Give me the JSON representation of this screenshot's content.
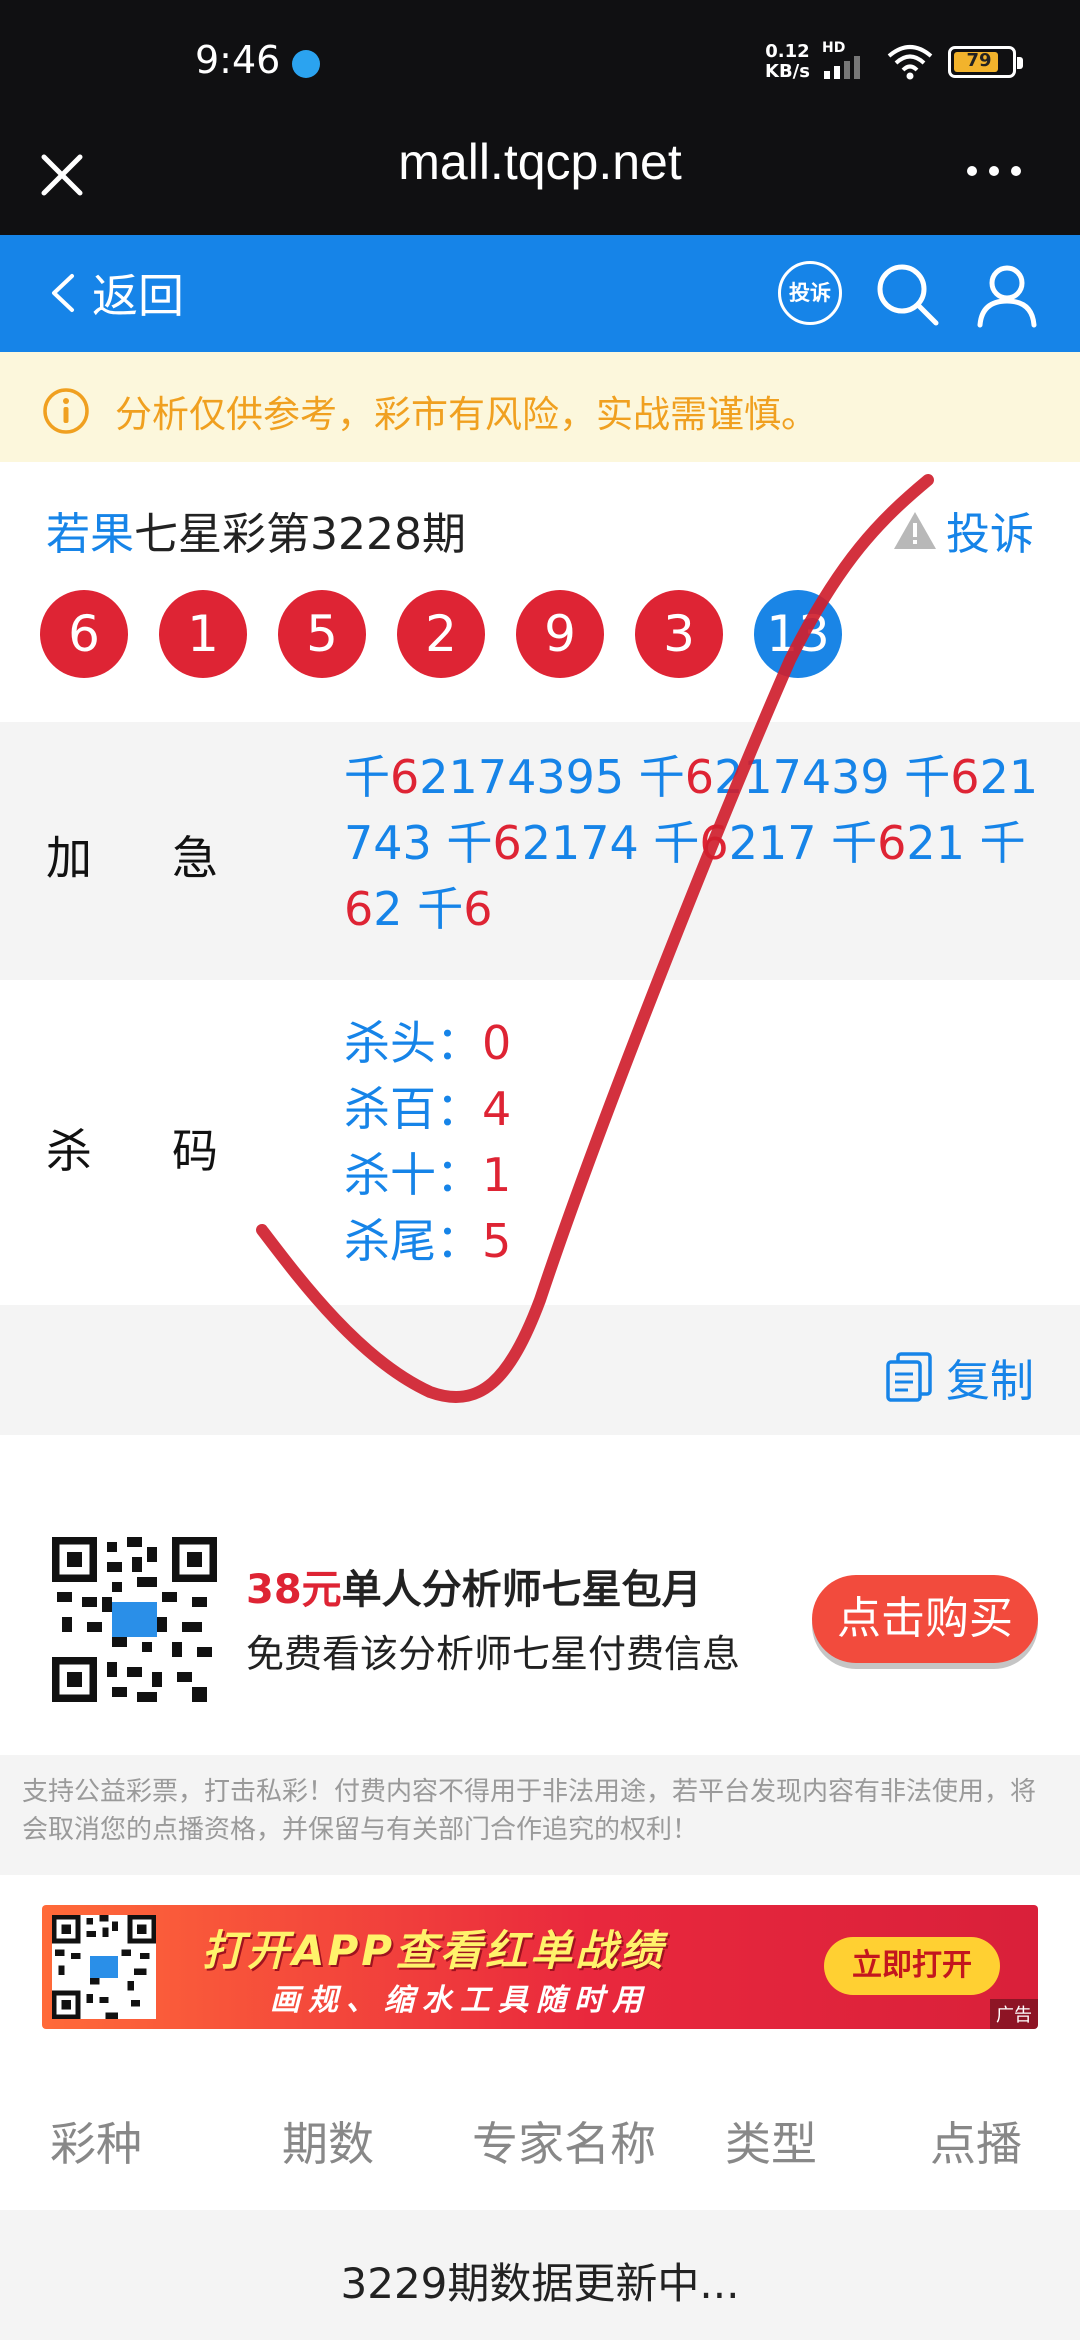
{
  "status_bar": {
    "time": "9:46",
    "net_speed_value": "0.12",
    "net_speed_unit": "KB/s",
    "net_type": "HD",
    "battery": "79"
  },
  "browser": {
    "url": "mall.tqcp.net"
  },
  "header": {
    "back_label": "返回",
    "complain_label": "投诉"
  },
  "notice": {
    "text": "分析仅供参考，彩市有风险，实战需谨慎。"
  },
  "issue": {
    "expert_name": "若果",
    "title": "七星彩第3228期",
    "report_label": "投诉",
    "balls": [
      "6",
      "1",
      "5",
      "2",
      "9",
      "3",
      "13"
    ]
  },
  "analysis": {
    "rows": [
      {
        "label": "加急",
        "items": [
          {
            "prefix": "千",
            "lead": "6",
            "rest": "2174395"
          },
          {
            "prefix": "千",
            "lead": "6",
            "rest": "217439"
          },
          {
            "prefix": "千",
            "lead": "6",
            "rest": "21743"
          },
          {
            "prefix": "千",
            "lead": "6",
            "rest": "2174"
          },
          {
            "prefix": "千",
            "lead": "6",
            "rest": "217"
          },
          {
            "prefix": "千",
            "lead": "6",
            "rest": "21"
          },
          {
            "prefix": "千",
            "lead": "6",
            "rest": "2"
          },
          {
            "prefix": "千",
            "lead": "6",
            "rest": ""
          }
        ]
      },
      {
        "label": "杀码",
        "items": [
          {
            "key": "杀头：",
            "value": "0"
          },
          {
            "key": "杀百：",
            "value": "4"
          },
          {
            "key": "杀十：",
            "value": "1"
          },
          {
            "key": "杀尾：",
            "value": "5"
          }
        ]
      }
    ],
    "copy_label": "复制"
  },
  "promo": {
    "price": "38元",
    "title": "单人分析师七星包月",
    "subtitle": "免费看该分析师七星付费信息",
    "button": "点击购买"
  },
  "disclaimer": "支持公益彩票，打击私彩！付费内容不得用于非法用途，若平台发现内容有非法使用，将会取消您的点播资格，并保留与有关部门合作追究的权利！",
  "banner": {
    "line1": "打开APP查看红单战绩",
    "line2": "画规、缩水工具随时用",
    "button": "立即打开",
    "ad_tag": "广告"
  },
  "table": {
    "columns": [
      "彩种",
      "期数",
      "专家名称",
      "类型",
      "点播"
    ],
    "status_row": "3229期数据更新中..."
  },
  "colors": {
    "accent_blue": "#1684e8",
    "red": "#de2434",
    "notice_text": "#f0a020"
  },
  "icons": [
    "close-icon",
    "more-icon",
    "chevron-left-icon",
    "search-icon",
    "user-icon",
    "info-icon",
    "warning-icon",
    "copy-icon",
    "qr-code-icon"
  ]
}
